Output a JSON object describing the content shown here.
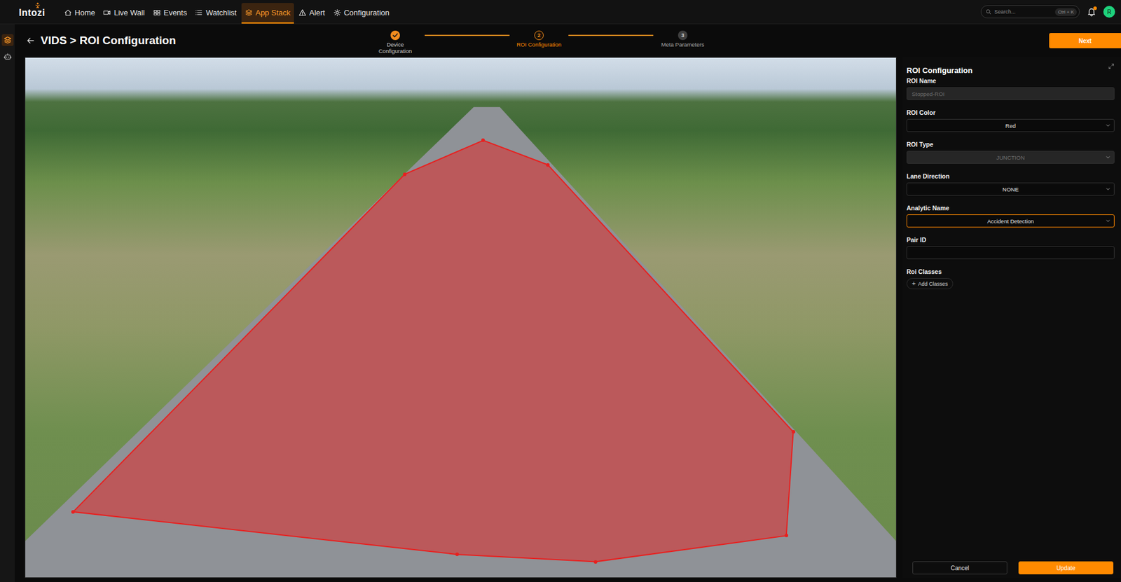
{
  "app": {
    "logo": "Intozi"
  },
  "nav": [
    {
      "label": "Home",
      "selected": false
    },
    {
      "label": "Live Wall",
      "selected": false
    },
    {
      "label": "Events",
      "selected": false
    },
    {
      "label": "Watchlist",
      "selected": false
    },
    {
      "label": "App Stack",
      "selected": true
    },
    {
      "label": "Alert",
      "selected": false
    },
    {
      "label": "Configuration",
      "selected": false
    }
  ],
  "search": {
    "placeholder": "Search...",
    "shortcut": "Ctrl + K"
  },
  "notifications": {
    "unread": true
  },
  "user": {
    "initial": "R"
  },
  "sidebar": {
    "items": [
      {
        "selected": true
      },
      {
        "selected": false
      }
    ]
  },
  "page": {
    "title": "VIDS > ROI Configuration"
  },
  "stepper": [
    {
      "number": "",
      "label": "Device Configuration",
      "state": "done"
    },
    {
      "number": "2",
      "label": "ROI Configuration",
      "state": "active"
    },
    {
      "number": "3",
      "label": "Meta Parameters",
      "state": "pending"
    }
  ],
  "next_button": "Next",
  "video": {
    "roi": {
      "color": "#e8201f",
      "points": [
        [
          0.055,
          0.874
        ],
        [
          0.436,
          0.224
        ],
        [
          0.526,
          0.159
        ],
        [
          0.6,
          0.206
        ],
        [
          0.882,
          0.72
        ],
        [
          0.874,
          0.92
        ],
        [
          0.655,
          0.97
        ],
        [
          0.496,
          0.956
        ]
      ]
    }
  },
  "panel": {
    "title": "ROI Configuration",
    "fields": [
      {
        "label": "ROI Name",
        "kind": "input",
        "value": "Stopped-ROI",
        "disabled": true,
        "focused": false
      },
      {
        "label": "ROI Color",
        "kind": "select",
        "value": "Red",
        "disabled": false,
        "focused": false
      },
      {
        "label": "ROI Type",
        "kind": "select",
        "value": "JUNCTION",
        "disabled": true,
        "focused": false
      },
      {
        "label": "Lane Direction",
        "kind": "select",
        "value": "NONE",
        "disabled": false,
        "focused": false
      },
      {
        "label": "Analytic Name",
        "kind": "select",
        "value": "Accident Detection",
        "disabled": false,
        "focused": true
      },
      {
        "label": "Pair ID",
        "kind": "input",
        "value": "",
        "disabled": false,
        "focused": false
      }
    ],
    "roi_classes": {
      "label": "Roi Classes",
      "icon": "+",
      "button": "Add Classes"
    },
    "buttons": {
      "cancel": "Cancel",
      "update": "Update"
    }
  }
}
